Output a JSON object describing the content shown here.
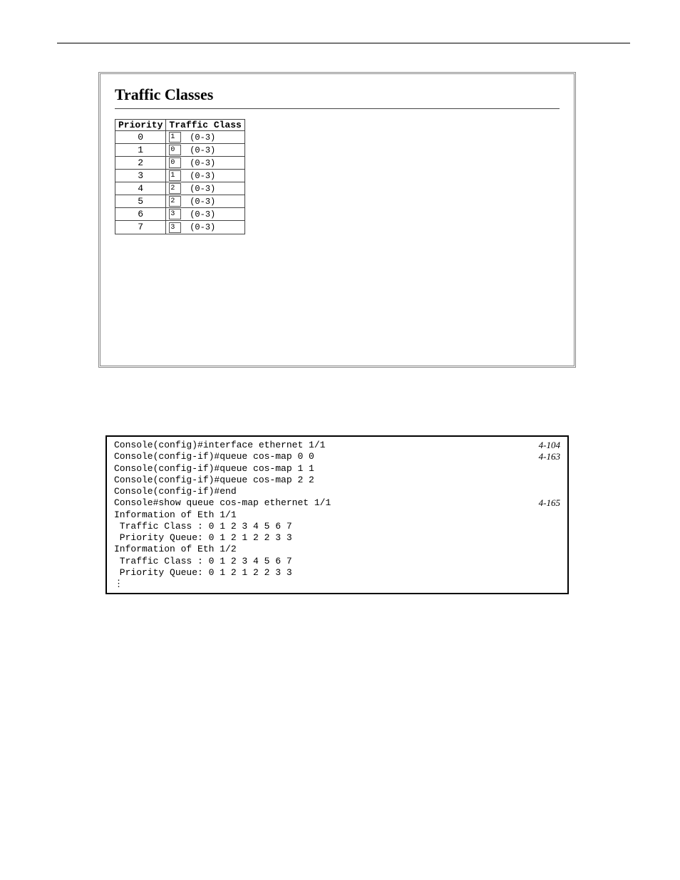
{
  "panel": {
    "title": "Traffic Classes",
    "headers": {
      "priority": "Priority",
      "traffic_class": "Traffic Class"
    },
    "range_label": "(0-3)",
    "rows": [
      {
        "priority": "0",
        "value": "1"
      },
      {
        "priority": "1",
        "value": "0"
      },
      {
        "priority": "2",
        "value": "0"
      },
      {
        "priority": "3",
        "value": "1"
      },
      {
        "priority": "4",
        "value": "2"
      },
      {
        "priority": "5",
        "value": "2"
      },
      {
        "priority": "6",
        "value": "3"
      },
      {
        "priority": "7",
        "value": "3"
      }
    ]
  },
  "console": {
    "lines": [
      {
        "left": "Console(config)#interface ethernet 1/1",
        "right": "4-104"
      },
      {
        "left": "Console(config-if)#queue cos-map 0 0",
        "right": "4-163"
      },
      {
        "left": "Console(config-if)#queue cos-map 1 1",
        "right": ""
      },
      {
        "left": "Console(config-if)#queue cos-map 2 2",
        "right": ""
      },
      {
        "left": "Console(config-if)#end",
        "right": ""
      },
      {
        "left": "Console#show queue cos-map ethernet 1/1",
        "right": "4-165"
      },
      {
        "left": "Information of Eth 1/1",
        "right": ""
      },
      {
        "left": " Traffic Class : 0 1 2 3 4 5 6 7",
        "right": ""
      },
      {
        "left": " Priority Queue: 0 1 2 1 2 2 3 3",
        "right": ""
      },
      {
        "left": "Information of Eth 1/2",
        "right": ""
      },
      {
        "left": " Traffic Class : 0 1 2 3 4 5 6 7",
        "right": ""
      },
      {
        "left": " Priority Queue: 0 1 2 1 2 2 3 3",
        "right": ""
      },
      {
        "left": "⋮",
        "right": ""
      }
    ]
  }
}
